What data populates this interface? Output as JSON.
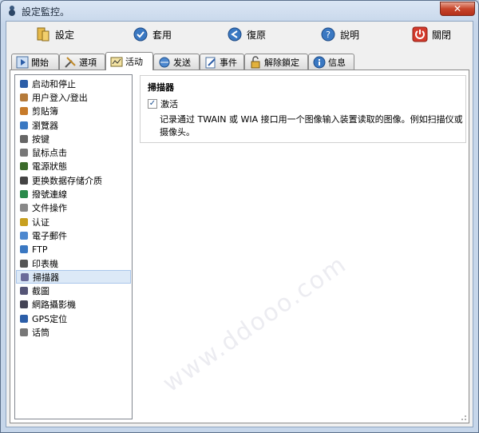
{
  "window": {
    "title": "設定監控。",
    "close_label": "✕"
  },
  "toolbar": {
    "settings": "設定",
    "apply": "套用",
    "restore": "復原",
    "help": "說明",
    "close": "關閉"
  },
  "tabs": [
    "開始",
    "選項",
    "活动",
    "发送",
    "事件",
    "解除鎖定",
    "信息"
  ],
  "sidebar": {
    "items": [
      "启动和停止",
      "用户登入/登出",
      "剪貼簿",
      "瀏覽器",
      "按键",
      "鼠标点击",
      "電源狀態",
      "更换数据存储介质",
      "撥號連線",
      "文件操作",
      "认证",
      "電子郵件",
      "FTP",
      "印表機",
      "掃描器",
      "截圖",
      "網路攝影機",
      "GPS定位",
      "话筒"
    ],
    "selected": "掃描器"
  },
  "detail": {
    "title": "掃描器",
    "checkbox_label": "激活",
    "checkbox_checked": true,
    "description": "记录通过 TWAIN 或 WIA 接口用一个图像输入装置读取的图像。例如扫描仪或摄像头。"
  },
  "watermark": "www.ddooo.com",
  "colors": {
    "accent": "#1b4f91",
    "selection": "#dce9f7",
    "close_red": "#c7452b"
  }
}
